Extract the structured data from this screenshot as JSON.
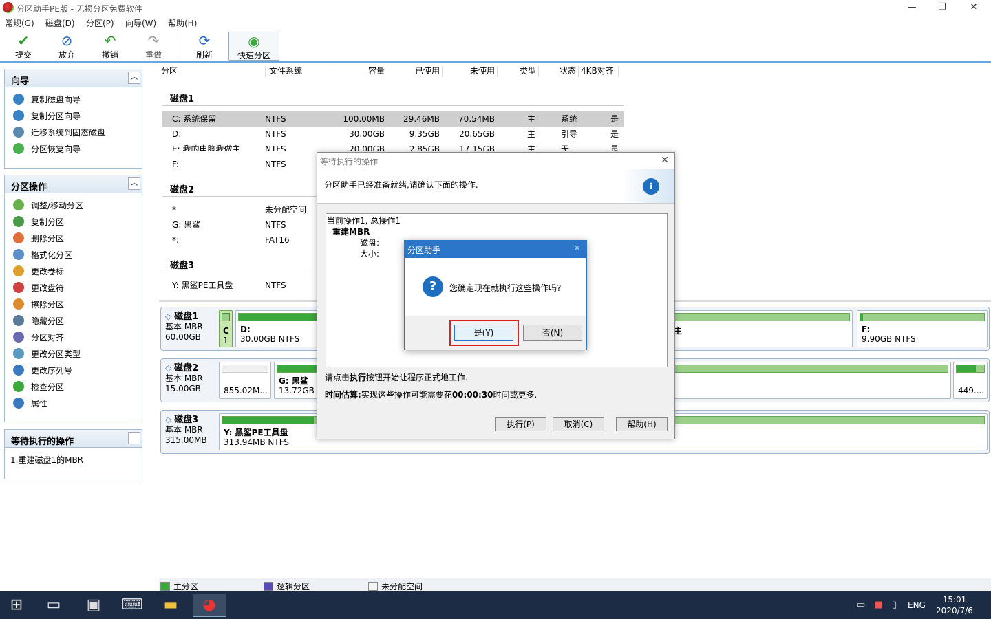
{
  "window": {
    "title": "分区助手PE版 - 无损分区免费软件",
    "minimize": "—",
    "maximize": "❐",
    "close": "✕"
  },
  "menu": [
    "常规(G)",
    "磁盘(D)",
    "分区(P)",
    "向导(W)",
    "帮助(H)"
  ],
  "toolbar": {
    "commit": "提交",
    "discard": "放弃",
    "undo": "撤销",
    "redo": "重做",
    "refresh": "刷新",
    "quick_partition": "快速分区"
  },
  "sidebar": {
    "wizard": {
      "title": "向导",
      "items": [
        "复制磁盘向导",
        "复制分区向导",
        "迁移系统到固态磁盘",
        "分区恢复向导"
      ]
    },
    "ops": {
      "title": "分区操作",
      "items": [
        "调整/移动分区",
        "复制分区",
        "删除分区",
        "格式化分区",
        "更改卷标",
        "更改盘符",
        "擦除分区",
        "隐藏分区",
        "分区对齐",
        "更改分区类型",
        "更改序列号",
        "检查分区",
        "属性"
      ]
    },
    "pending": {
      "title": "等待执行的操作",
      "items": [
        "1.重建磁盘1的MBR"
      ]
    }
  },
  "columns": [
    "分区",
    "文件系统",
    "容量",
    "已使用",
    "未使用",
    "类型",
    "状态",
    "4KB对齐"
  ],
  "disks": [
    {
      "name": "磁盘1",
      "rows": [
        {
          "p": "C: 系统保留",
          "fs": "NTFS",
          "cap": "100.00MB",
          "used": "29.46MB",
          "free": "70.54MB",
          "type": "主",
          "status": "系统",
          "align": "是"
        },
        {
          "p": "D:",
          "fs": "NTFS",
          "cap": "30.00GB",
          "used": "9.35GB",
          "free": "20.65GB",
          "type": "主",
          "status": "引导",
          "align": "是"
        },
        {
          "p": "E: 我的电脑我做主",
          "fs": "NTFS",
          "cap": "20.00GB",
          "used": "2.85GB",
          "free": "17.15GB",
          "type": "主",
          "status": "无",
          "align": "是"
        },
        {
          "p": "F:",
          "fs": "NTFS",
          "cap": "",
          "used": "",
          "free": "",
          "type": "",
          "status": "",
          "align": ""
        }
      ]
    },
    {
      "name": "磁盘2",
      "rows": [
        {
          "p": "*",
          "fs": "未分配空间"
        },
        {
          "p": "G: 黑鲨",
          "fs": "NTFS"
        },
        {
          "p": "*:",
          "fs": "FAT16"
        }
      ]
    },
    {
      "name": "磁盘3",
      "rows": [
        {
          "p": "Y: 黑鲨PE工具盘",
          "fs": "NTFS"
        }
      ]
    }
  ],
  "map": {
    "disk1": {
      "name": "磁盘1",
      "type": "基本 MBR",
      "size": "60.00GB",
      "c_label": "C",
      "c_num": "1",
      "d_label": "D:",
      "d_info": "30.00GB NTFS",
      "e_partial": "主",
      "f_label": "F:",
      "f_info": "9.90GB NTFS"
    },
    "disk2": {
      "name": "磁盘2",
      "type": "基本 MBR",
      "size": "15.00GB",
      "unalloc": "855.02M...",
      "g_label": "G: 黑鲨",
      "g_info": "13.72GB",
      "last": "449...."
    },
    "disk3": {
      "name": "磁盘3",
      "type": "基本 MBR",
      "size": "315.00MB",
      "y_label": "Y: 黑鲨PE工具盘",
      "y_info": "313.94MB NTFS"
    }
  },
  "legend": {
    "primary": "主分区",
    "logical": "逻辑分区",
    "unallocated": "未分配空间"
  },
  "dialog_pending": {
    "title": "等待执行的操作",
    "header": "分区助手已经准备就绪,请确认下面的操作.",
    "list": {
      "line1": "当前操作1, 总操作1",
      "line2": "重建MBR",
      "disk_label": "磁盘:",
      "size_label": "大小:"
    },
    "hint_pre": "请点击",
    "hint_bold": "执行",
    "hint_post": "按钮开始让程序正式地工作.",
    "time_label": "时间估算:",
    "time_pre": "实现这些操作可能需要花",
    "time_value": "00:00:30",
    "time_post": "时间或更多.",
    "execute": "执行(P)",
    "cancel": "取消(C)",
    "help": "帮助(H)"
  },
  "dialog_confirm": {
    "title": "分区助手",
    "message": "您确定现在就执行这些操作吗?",
    "yes": "是(Y)",
    "no": "否(N)"
  },
  "tray": {
    "lang": "ENG",
    "time": "15:01",
    "date": "2020/7/6"
  },
  "colors": {
    "accent": "#2b76c8",
    "highlight": "#e02020",
    "green": "#3aa83a"
  }
}
